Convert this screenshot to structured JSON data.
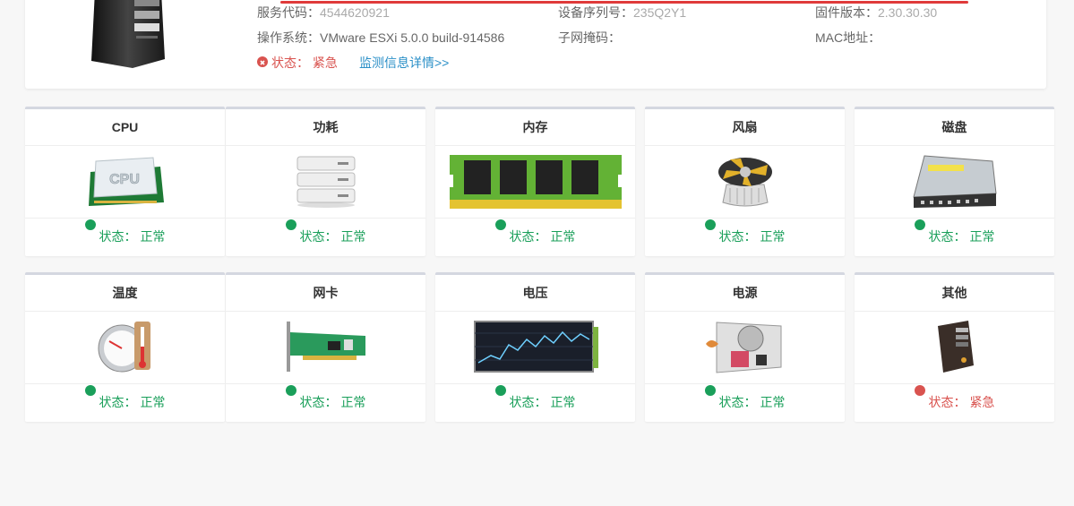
{
  "server": {
    "service_code_label": "服务代码：",
    "service_code": "4544620921",
    "serial_label": "设备序列号：",
    "serial": "235Q2Y1",
    "firmware_label": "固件版本：",
    "firmware": "2.30.30.30",
    "os_label": "操作系统：",
    "os": "VMware ESXi 5.0.0 build-914586",
    "subnet_label": "子网掩码：",
    "subnet": "",
    "mac_label": "MAC地址：",
    "mac": "",
    "status_label": "状态：",
    "status": "紧急",
    "detail_link": "监测信息详情>>"
  },
  "cards": [
    {
      "title": "CPU",
      "status_label": "状态：",
      "status": "正常",
      "ok": true,
      "icon": "cpu-icon"
    },
    {
      "title": "功耗",
      "status_label": "状态：",
      "status": "正常",
      "ok": true,
      "icon": "server-rack-icon"
    },
    {
      "title": "内存",
      "status_label": "状态：",
      "status": "正常",
      "ok": true,
      "icon": "memory-icon"
    },
    {
      "title": "风扇",
      "status_label": "状态：",
      "status": "正常",
      "ok": true,
      "icon": "fan-icon"
    },
    {
      "title": "磁盘",
      "status_label": "状态：",
      "status": "正常",
      "ok": true,
      "icon": "disk-icon"
    },
    {
      "title": "温度",
      "status_label": "状态：",
      "status": "正常",
      "ok": true,
      "icon": "thermometer-gauge-icon"
    },
    {
      "title": "网卡",
      "status_label": "状态：",
      "status": "正常",
      "ok": true,
      "icon": "network-card-icon"
    },
    {
      "title": "电压",
      "status_label": "状态：",
      "status": "正常",
      "ok": true,
      "icon": "voltage-chart-icon"
    },
    {
      "title": "电源",
      "status_label": "状态：",
      "status": "正常",
      "ok": true,
      "icon": "power-supply-icon"
    },
    {
      "title": "其他",
      "status_label": "状态：",
      "status": "紧急",
      "ok": false,
      "icon": "tower-server-icon"
    }
  ],
  "colors": {
    "ok": "#1a9f5a",
    "error": "#d9534f",
    "link": "#2a8fc7"
  }
}
